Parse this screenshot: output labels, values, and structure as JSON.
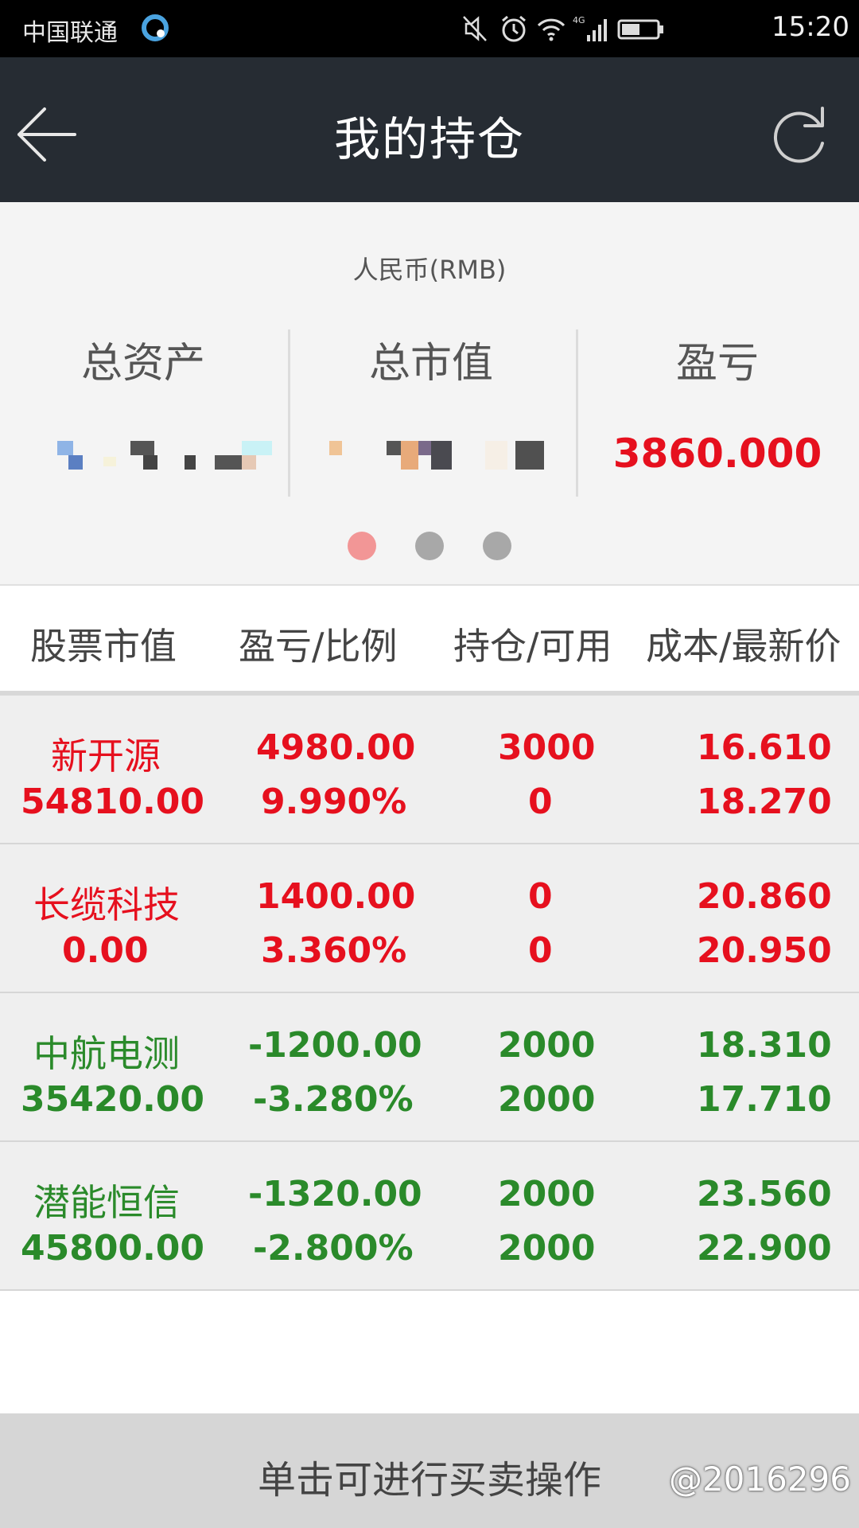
{
  "status_bar": {
    "carrier": "中国联通",
    "time": "15:20",
    "network": "4G"
  },
  "header": {
    "title": "我的持仓",
    "back_icon": "back-arrow-icon",
    "refresh_icon": "refresh-icon"
  },
  "summary": {
    "currency": "人民币(RMB)",
    "total_assets_label": "总资产",
    "market_value_label": "总市值",
    "pnl_label": "盈亏",
    "pnl_value": "3860.000",
    "page_count": 3,
    "active_page": 1
  },
  "table": {
    "headers": [
      "股票市值",
      "盈亏/比例",
      "持仓/可用",
      "成本/最新价"
    ],
    "rows": [
      {
        "name": "新开源",
        "market_value": "54810.00",
        "pnl": "4980.00",
        "pnl_ratio": "9.990%",
        "position": "3000",
        "available": "0",
        "cost": "16.610",
        "latest": "18.270",
        "trend": "up"
      },
      {
        "name": "长缆科技",
        "market_value": "0.00",
        "pnl": "1400.00",
        "pnl_ratio": "3.360%",
        "position": "0",
        "available": "0",
        "cost": "20.860",
        "latest": "20.950",
        "trend": "up"
      },
      {
        "name": "中航电测",
        "market_value": "35420.00",
        "pnl": "-1200.00",
        "pnl_ratio": "-3.280%",
        "position": "2000",
        "available": "2000",
        "cost": "18.310",
        "latest": "17.710",
        "trend": "down"
      },
      {
        "name": "潜能恒信",
        "market_value": "45800.00",
        "pnl": "-1320.00",
        "pnl_ratio": "-2.800%",
        "position": "2000",
        "available": "2000",
        "cost": "23.560",
        "latest": "22.900",
        "trend": "down"
      }
    ]
  },
  "footer": {
    "action_label": "单击可进行买卖操作",
    "watermark": "@2016296"
  },
  "colors": {
    "up": "#e6101e",
    "down": "#2a8a2a",
    "titlebar": "#262c33"
  }
}
